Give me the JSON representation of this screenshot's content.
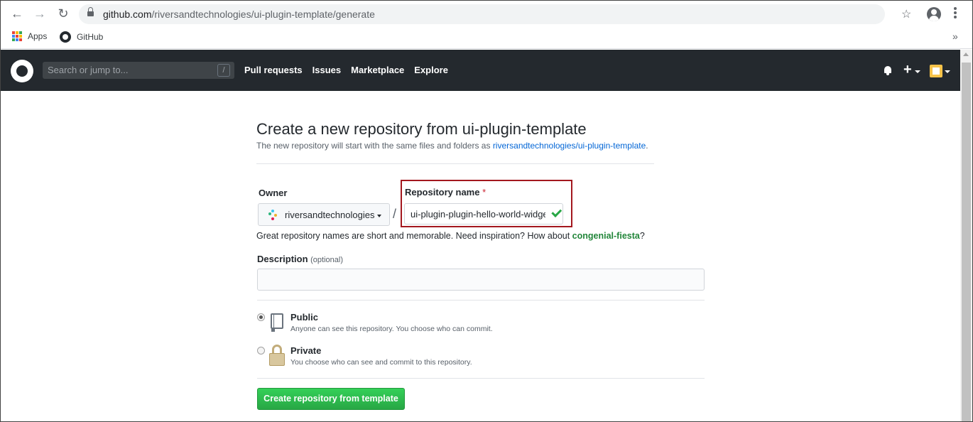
{
  "browser": {
    "url_host": "github.com",
    "url_path": "/riversandtechnologies/ui-plugin-template/generate",
    "bookmarks": [
      {
        "label": "Apps"
      },
      {
        "label": "GitHub"
      }
    ]
  },
  "header": {
    "search_placeholder": "Search or jump to...",
    "search_shortcut": "/",
    "nav": [
      "Pull requests",
      "Issues",
      "Marketplace",
      "Explore"
    ],
    "plus": "+"
  },
  "page": {
    "title": "Create a new repository from ui-plugin-template",
    "subtitle_prefix": "The new repository will start with the same files and folders as ",
    "subtitle_link": "riversandtechnologies/ui-plugin-template",
    "subtitle_suffix": "."
  },
  "form": {
    "owner_label": "Owner",
    "owner_value": "riversandtechnologies",
    "separator": "/",
    "repo_label": "Repository name",
    "required_mark": "*",
    "repo_value": "ui-plugin-plugin-hello-world-widget",
    "hint_prefix": "Great repository names are short and memorable. Need inspiration? How about ",
    "hint_suggestion": "congenial-fiesta",
    "hint_suffix": "?",
    "description_label": "Description",
    "description_optional": "(optional)",
    "description_value": "",
    "visibility": [
      {
        "title": "Public",
        "desc": "Anyone can see this repository. You choose who can commit.",
        "selected": true
      },
      {
        "title": "Private",
        "desc": "You choose who can see and commit to this repository.",
        "selected": false
      }
    ],
    "submit_label": "Create repository from template"
  },
  "colors": {
    "header_bg": "#24292e",
    "link": "#0366d6",
    "primary_button": "#2ea44f",
    "highlight_box": "#a3171e",
    "suggestion": "#22863a"
  }
}
